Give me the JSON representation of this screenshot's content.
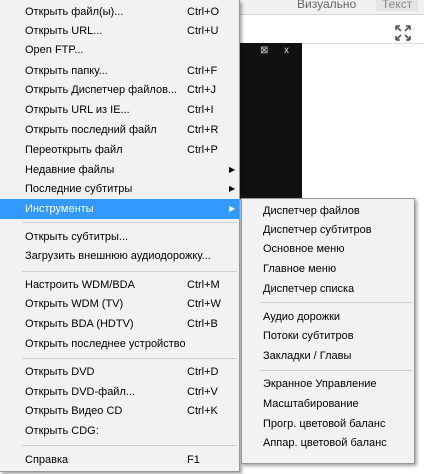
{
  "background": {
    "tabs": [
      "Визуально",
      "Текст"
    ],
    "window_controls": [
      "⊠",
      "x"
    ]
  },
  "main_menu": {
    "items": [
      {
        "label": "Открыть файл(ы)...",
        "shortcut": "Ctrl+O"
      },
      {
        "label": "Открыть URL...",
        "shortcut": "Ctrl+U"
      },
      {
        "label": "Open FTP...",
        "shortcut": ""
      },
      {
        "label": "Открыть папку...",
        "shortcut": "Ctrl+F"
      },
      {
        "label": "Открыть Диспетчер файлов...",
        "shortcut": "Ctrl+J"
      },
      {
        "label": "Открыть URL из IE...",
        "shortcut": "Ctrl+I"
      },
      {
        "label": "Открыть последний файл",
        "shortcut": "Ctrl+R"
      },
      {
        "label": "Переоткрыть файл",
        "shortcut": "Ctrl+P"
      },
      {
        "label": "Недавние файлы",
        "shortcut": "",
        "submenu": true
      },
      {
        "label": "Последние субтитры",
        "shortcut": "",
        "submenu": true
      },
      {
        "label": "Инструменты",
        "shortcut": "",
        "submenu": true,
        "highlighted": true
      },
      {
        "label": "Открыть субтитры...",
        "shortcut": ""
      },
      {
        "label": "Загрузить внешнюю аудиодорожку...",
        "shortcut": ""
      },
      {
        "label": "Настроить WDM/BDA",
        "shortcut": "Ctrl+M"
      },
      {
        "label": "Открыть WDM (TV)",
        "shortcut": "Ctrl+W"
      },
      {
        "label": "Открыть BDA (HDTV)",
        "shortcut": "Ctrl+B"
      },
      {
        "label": "Открыть последнее устройство",
        "shortcut": ""
      },
      {
        "label": "Открыть DVD",
        "shortcut": "Ctrl+D"
      },
      {
        "label": "Открыть DVD-файл...",
        "shortcut": "Ctrl+V"
      },
      {
        "label": "Открыть Видео CD",
        "shortcut": "Ctrl+K"
      },
      {
        "label": "Открыть CDG:",
        "shortcut": ""
      },
      {
        "label": "Справка",
        "shortcut": "F1"
      }
    ],
    "submenu_arrow": "▶"
  },
  "tools_submenu": {
    "items": [
      "Диспетчер файлов",
      "Диспетчер субтитров",
      "Основное меню",
      "Главное меню",
      "Диспетчер списка",
      "Аудио дорожки",
      "Потоки субтитров",
      "Закладки / Главы",
      "Экранное Управление",
      "Масштабирование",
      "Прогр. цветовой баланс",
      "Аппар. цветовой баланс"
    ]
  },
  "colors": {
    "menu_bg": "#f2f2f2",
    "highlight": "#3399ff",
    "separator": "#cfcfcf",
    "video_area": "#111111"
  }
}
